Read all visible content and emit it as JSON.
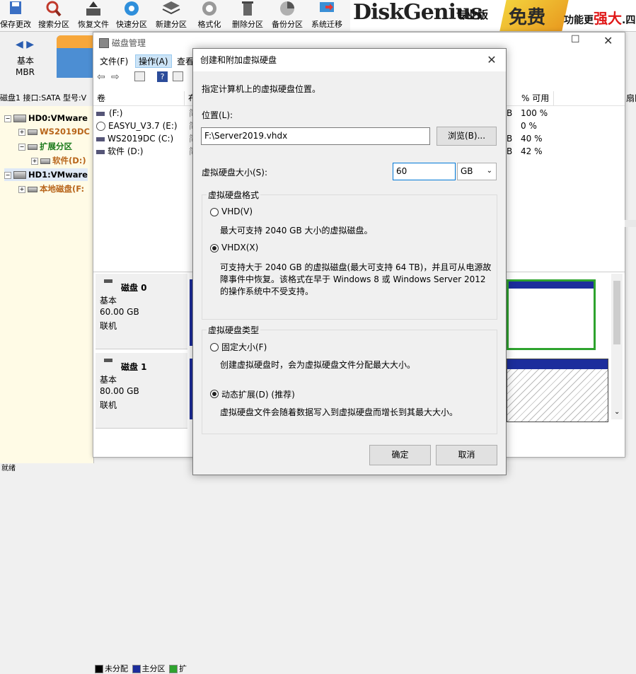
{
  "toolbar": {
    "items": [
      {
        "label": "保存更改",
        "icon": "save-icon"
      },
      {
        "label": "搜索分区",
        "icon": "search-icon"
      },
      {
        "label": "恢复文件",
        "icon": "recover-icon"
      },
      {
        "label": "快速分区",
        "icon": "quick-partition-icon"
      },
      {
        "label": "新建分区",
        "icon": "new-partition-icon"
      },
      {
        "label": "格式化",
        "icon": "format-icon"
      },
      {
        "label": "删除分区",
        "icon": "delete-icon"
      },
      {
        "label": "备份分区",
        "icon": "backup-icon"
      },
      {
        "label": "系统迁移",
        "icon": "migrate-icon"
      }
    ]
  },
  "brand": {
    "logo": "DiskGenius",
    "edition": "专业版",
    "art": "免费",
    "slogan_prefix": "功能更",
    "slogan_emph": "强大",
    "slogan_suffix": ".四"
  },
  "leftnav": {
    "basic": "基本",
    "mbr": "MBR"
  },
  "infobar": "磁盘1 接口:SATA  型号:V",
  "tree": {
    "hd0": "HD0:VMware",
    "p1": "WS2019DC",
    "ext": "扩展分区",
    "p2": "软件(D:)",
    "hd1": "HD1:VMware",
    "p3": "本地磁盘(F:"
  },
  "statusbar": "就绪",
  "dm": {
    "title": "磁盘管理",
    "menus": [
      "文件(F)",
      "操作(A)",
      "查看"
    ],
    "col_volume": "卷",
    "col_layout": "布",
    "col_pct": "% 可用",
    "col_extra": "扇区",
    "volumes": [
      {
        "name": "(F:)",
        "unit": "B",
        "pct": "100 %"
      },
      {
        "name": "EASYU_V3.7 (E:)",
        "unit": "B",
        "pct": "0 %"
      },
      {
        "name": "WS2019DC (C:)",
        "unit": "B",
        "pct": "40 %"
      },
      {
        "name": "软件 (D:)",
        "unit": "B",
        "pct": "42 %"
      }
    ],
    "layout_char": "简",
    "disks": [
      {
        "name": "磁盘 0",
        "type": "基本",
        "size": "60.00 GB",
        "status": "联机"
      },
      {
        "name": "磁盘 1",
        "type": "基本",
        "size": "80.00 GB",
        "status": "联机"
      }
    ],
    "legend": {
      "unalloc": "未分配",
      "primary": "主分区",
      "more": "扩"
    }
  },
  "dialog": {
    "title": "创建和附加虚拟硬盘",
    "instruction": "指定计算机上的虚拟硬盘位置。",
    "location_label": "位置(L):",
    "location_value": "F:\\Server2019.vhdx",
    "browse": "浏览(B)...",
    "size_label": "虚拟硬盘大小(S):",
    "size_value": "60",
    "unit": "GB",
    "format_group": "虚拟硬盘格式",
    "vhd_label": "VHD(V)",
    "vhd_desc": "最大可支持 2040 GB 大小的虚拟磁盘。",
    "vhdx_label": "VHDX(X)",
    "vhdx_desc_1": "可支持大于 2040 GB 的虚拟磁盘(最大可支持 64 TB)，并且可从电源故",
    "vhdx_desc_2": "障事件中恢复。该格式在早于 Windows 8 或 Windows Server 2012",
    "vhdx_desc_3": "的操作系统中不受支持。",
    "type_group": "虚拟硬盘类型",
    "fixed_label": "固定大小(F)",
    "fixed_desc": "创建虚拟硬盘时，会为虚拟硬盘文件分配最大大小。",
    "dynamic_label": "动态扩展(D) (推荐)",
    "dynamic_desc": "虚拟硬盘文件会随着数据写入到虚拟硬盘而增长到其最大大小。",
    "ok": "确定",
    "cancel": "取消"
  }
}
